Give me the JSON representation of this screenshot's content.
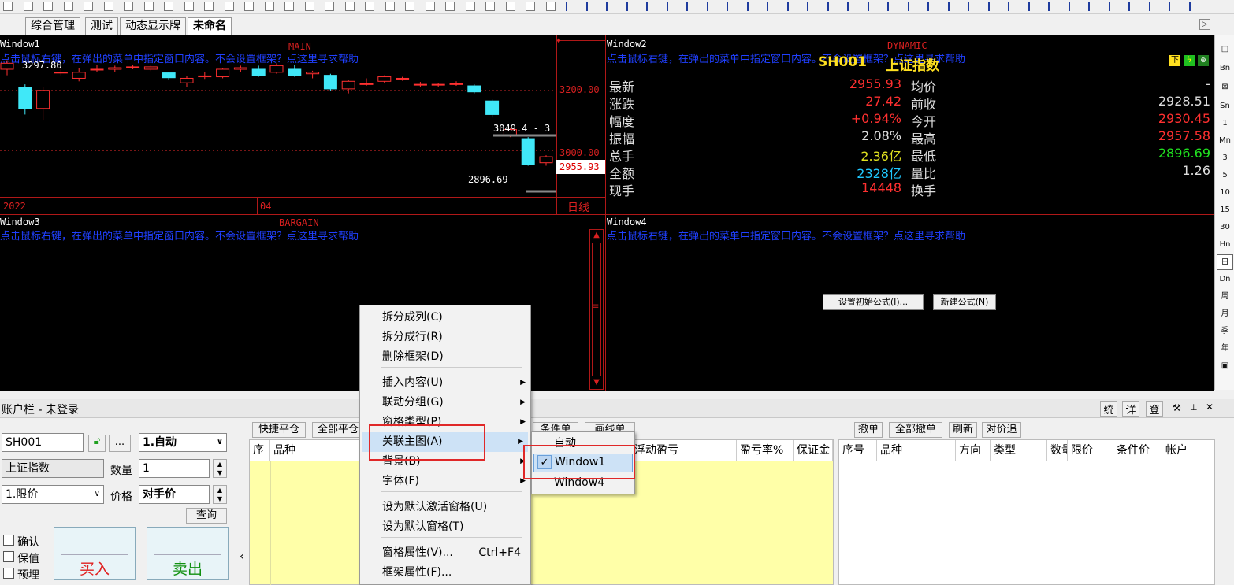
{
  "tabs": [
    {
      "label": "综合管理"
    },
    {
      "label": "测试"
    },
    {
      "label": "动态显示牌"
    },
    {
      "label": "未命名"
    }
  ],
  "sidebar": {
    "items": [
      "Bn",
      "Sn",
      "1",
      "Mn",
      "3",
      "5",
      "10",
      "15",
      "30",
      "Hn",
      "日",
      "Dn",
      "周",
      "月",
      "季",
      "年"
    ]
  },
  "main_chart": {
    "window_label": "Window1",
    "title": "MAIN",
    "help": "点击鼠标右键，在弹出的菜单中指定窗口内容。不会设置框架？点这里寻求帮助",
    "high_label": "3297.80",
    "low_label": "2896.69",
    "mid_label": "3049.4 - 3",
    "price_current": "2955.93",
    "x_labels": [
      "2022",
      "04"
    ],
    "period": "日线",
    "chart_data": {
      "type": "candlestick",
      "y_ticks": [
        3200.0,
        3000.0
      ],
      "ylim": [
        2860,
        3330
      ],
      "candles": [
        {
          "o": 3270,
          "c": 3290,
          "h": 3300,
          "l": 3250
        },
        {
          "o": 3210,
          "c": 3140,
          "h": 3220,
          "l": 3120
        },
        {
          "o": 3140,
          "c": 3200,
          "h": 3210,
          "l": 3100
        },
        {
          "o": 3260,
          "c": 3260,
          "h": 3275,
          "l": 3250
        },
        {
          "o": 3240,
          "c": 3260,
          "h": 3275,
          "l": 3230
        },
        {
          "o": 3270,
          "c": 3270,
          "h": 3285,
          "l": 3260
        },
        {
          "o": 3270,
          "c": 3275,
          "h": 3282,
          "l": 3262
        },
        {
          "o": 3278,
          "c": 3278,
          "h": 3285,
          "l": 3270
        },
        {
          "o": 3270,
          "c": 3278,
          "h": 3285,
          "l": 3264
        },
        {
          "o": 3258,
          "c": 3242,
          "h": 3262,
          "l": 3236
        },
        {
          "o": 3225,
          "c": 3240,
          "h": 3248,
          "l": 3212
        },
        {
          "o": 3245,
          "c": 3248,
          "h": 3260,
          "l": 3238
        },
        {
          "o": 3245,
          "c": 3270,
          "h": 3275,
          "l": 3240
        },
        {
          "o": 3270,
          "c": 3275,
          "h": 3282,
          "l": 3262
        },
        {
          "o": 3270,
          "c": 3250,
          "h": 3282,
          "l": 3245
        },
        {
          "o": 3260,
          "c": 3282,
          "h": 3290,
          "l": 3255
        },
        {
          "o": 3270,
          "c": 3250,
          "h": 3285,
          "l": 3245
        },
        {
          "o": 3255,
          "c": 3260,
          "h": 3265,
          "l": 3240
        },
        {
          "o": 3250,
          "c": 3205,
          "h": 3255,
          "l": 3198
        },
        {
          "o": 3205,
          "c": 3230,
          "h": 3235,
          "l": 3190
        },
        {
          "o": 3222,
          "c": 3222,
          "h": 3240,
          "l": 3215
        },
        {
          "o": 3230,
          "c": 3245,
          "h": 3250,
          "l": 3225
        },
        {
          "o": 3240,
          "c": 3240,
          "h": 3245,
          "l": 3232
        },
        {
          "o": 3220,
          "c": 3220,
          "h": 3228,
          "l": 3210
        },
        {
          "o": 3220,
          "c": 3220,
          "h": 3225,
          "l": 3212
        },
        {
          "o": 3222,
          "c": 3222,
          "h": 3230,
          "l": 3215
        },
        {
          "o": 3215,
          "c": 3195,
          "h": 3220,
          "l": 3190
        },
        {
          "o": 3165,
          "c": 3120,
          "h": 3170,
          "l": 3110
        },
        {
          "o": 3050,
          "c": 3070,
          "h": 3075,
          "l": 3045
        },
        {
          "o": 3040,
          "c": 2955,
          "h": 3045,
          "l": 2950
        },
        {
          "o": 2960,
          "c": 2980,
          "h": 2985,
          "l": 2950
        }
      ]
    }
  },
  "dynamic": {
    "window_label": "Window2",
    "title": "DYNAMIC",
    "help": "点击鼠标右键，在弹出的菜单中指定窗口内容。不会设置框架？点这里寻求帮助",
    "code": "SH001",
    "name": "上证指数",
    "rows": [
      {
        "l1": "最新",
        "v1": "2955.93",
        "c1": "#ff3030",
        "l2": "均价",
        "v2": "-",
        "c2": "#ddd"
      },
      {
        "l1": "涨跌",
        "v1": "27.42",
        "c1": "#ff3030",
        "l2": "前收",
        "v2": "2928.51",
        "c2": "#ddd"
      },
      {
        "l1": "幅度",
        "v1": "+0.94%",
        "c1": "#ff3030",
        "l2": "今开",
        "v2": "2930.45",
        "c2": "#ff3030"
      },
      {
        "l1": "振幅",
        "v1": "2.08%",
        "c1": "#ddd",
        "l2": "最高",
        "v2": "2957.58",
        "c2": "#ff3030"
      },
      {
        "l1": "总手",
        "v1": "2.36亿",
        "c1": "#e0e020",
        "l2": "最低",
        "v2": "2896.69",
        "c2": "#20e020"
      },
      {
        "l1": "全额",
        "v1": "2328亿",
        "c1": "#20c8ff",
        "l2": "量比",
        "v2": "1.26",
        "c2": "#ddd"
      },
      {
        "l1": "现手",
        "v1": "14448",
        "c1": "#ff3030",
        "l2": "换手",
        "v2": "",
        "c2": "#ddd"
      }
    ]
  },
  "bargain": {
    "window_label": "Window3",
    "title": "BARGAIN",
    "help": "点击鼠标右键，在弹出的菜单中指定窗口内容。不会设置框架？点这里寻求帮助"
  },
  "window4": {
    "window_label": "Window4",
    "help": "点击鼠标右键，在弹出的菜单中指定窗口内容。不会设置框架？点这里寻求帮助",
    "btn_formula_init": "设置初始公式(I)...",
    "btn_formula_new": "新建公式(N)"
  },
  "account": {
    "title": "账户栏 - 未登录",
    "btn_stat": "统",
    "btn_detail": "详",
    "btn_login": "登",
    "code_value": "SH001",
    "more": "...",
    "mode": "1.自动",
    "name": "上证指数",
    "qty_label": "数量",
    "qty_value": "1",
    "price_type": "1.限价",
    "price_label": "价格",
    "price_value": "对手价",
    "query": "查询",
    "chk_confirm": "确认",
    "chk_hold": "保值",
    "chk_preset": "预埋",
    "buy": "买入",
    "sell": "卖出"
  },
  "positions": {
    "btn_quick_close": "快捷平仓",
    "btn_close_all": "全部平仓",
    "btn_cond": "条件单",
    "btn_line": "画线单",
    "headers": [
      "序",
      "品种",
      "浮动盈亏",
      "盈亏率%",
      "保证金"
    ]
  },
  "orders": {
    "btn_cancel": "撤单",
    "btn_cancel_all": "全部撤单",
    "btn_refresh": "刷新",
    "btn_chase": "对价追",
    "headers": [
      "序号",
      "品种",
      "方向",
      "类型",
      "数量",
      "限价",
      "条件价",
      "帐户"
    ]
  },
  "context_menu": {
    "items": [
      {
        "label": "拆分成列(C)",
        "sub": false
      },
      {
        "label": "拆分成行(R)",
        "sub": false
      },
      {
        "label": "删除框架(D)",
        "sub": false
      },
      {
        "label": "插入内容(U)",
        "sub": true
      },
      {
        "label": "联动分组(G)",
        "sub": true
      },
      {
        "label": "窗格类型(P)",
        "sub": true
      },
      {
        "label": "关联主图(A)",
        "sub": true
      },
      {
        "label": "背景(B)",
        "sub": true
      },
      {
        "label": "字体(F)",
        "sub": true
      },
      {
        "label": "设为默认激活窗格(U)",
        "sub": false
      },
      {
        "label": "设为默认窗格(T)",
        "sub": false
      },
      {
        "label": "窗格属性(V)...",
        "sub": false
      },
      {
        "label": "框架属性(F)...",
        "sub": false
      }
    ],
    "shortcut_props": "Ctrl+F4"
  },
  "submenu": {
    "items": [
      {
        "label": "自动"
      },
      {
        "label": "Window1"
      },
      {
        "label": "Window4"
      }
    ],
    "check": "✓"
  }
}
